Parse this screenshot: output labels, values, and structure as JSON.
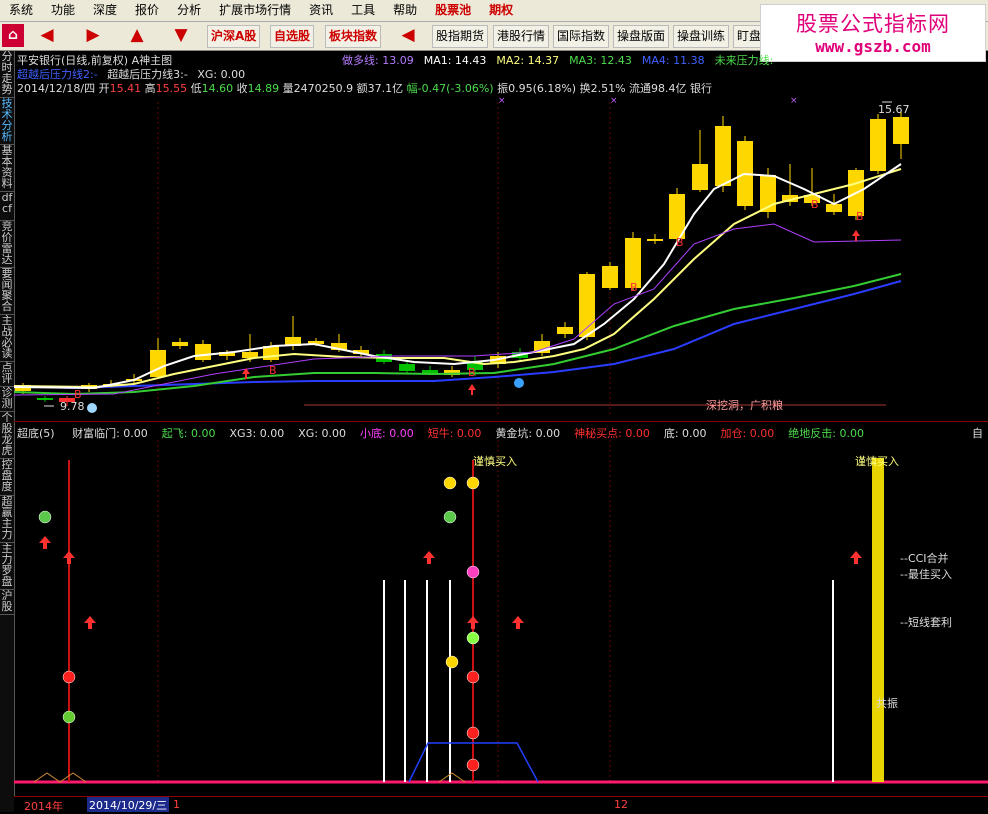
{
  "menu": [
    "系统",
    "功能",
    "深度",
    "报价",
    "分析",
    "扩展市场行情",
    "资讯",
    "工具",
    "帮助",
    "股票池",
    "期权"
  ],
  "watermark": {
    "line1": "股票公式指标网",
    "line2": "www.gszb.com"
  },
  "toolbar": {
    "tabs": [
      "沪深A股",
      "自选股",
      "板块指数",
      "股指期货",
      "港股行情",
      "国际指数",
      "操盘版面",
      "操盘训练",
      "盯盘"
    ]
  },
  "sidebar": [
    "分时走势",
    "技术分析",
    "基本资料",
    "dfcf",
    "竞价雷达",
    "要闻聚合",
    "主战必读",
    "点评",
    "诊测",
    "个股龙虎",
    "控盘度",
    "超赢主力",
    "主力罗盘",
    "沪股"
  ],
  "title_row": {
    "title": "平安银行(日线,前复权) A神主图",
    "items": [
      {
        "label": "做多线:",
        "value": "13.09",
        "color": "#b57cff"
      },
      {
        "label": "MA1:",
        "value": "14.43",
        "color": "#ffffff"
      },
      {
        "label": "MA2:",
        "value": "14.37",
        "color": "#ffff80"
      },
      {
        "label": "MA3:",
        "value": "12.43",
        "color": "#4cdc4c"
      },
      {
        "label": "MA4:",
        "value": "11.38",
        "color": "#4060ff"
      },
      {
        "label": "未来压力线:",
        "value": "",
        "color": "#4cdc4c"
      }
    ]
  },
  "row2": {
    "a": "超越后压力线2:-",
    "b": "超越后压力线3:-",
    "c": "XG: 0.00"
  },
  "quote": {
    "date": "2014/12/18/四",
    "open_l": "开",
    "open": "15.41",
    "high_l": "高",
    "high": "15.55",
    "low_l": "低",
    "low": "14.60",
    "close_l": "收",
    "close": "14.89",
    "vol": "量2470250.9",
    "amt": "额37.1亿",
    "chg": "幅-0.47(-3.06%)",
    "rest": "振0.95(6.18%) 换2.51% 流通98.4亿 银行"
  },
  "main_labels": {
    "max": "15.67",
    "min": "9.78",
    "dig": "深挖洞，广积粮"
  },
  "lower_row": {
    "name": "超底(5)",
    "items": [
      {
        "t": "财富临门: 0.00",
        "c": "#ddd"
      },
      {
        "t": "起飞: 0.00",
        "c": "#4cdc4c"
      },
      {
        "t": "XG3: 0.00",
        "c": "#ddd"
      },
      {
        "t": "XG: 0.00",
        "c": "#ddd"
      },
      {
        "t": "小底: 0.00",
        "c": "#ff40ff"
      },
      {
        "t": "短牛: 0.00",
        "c": "#ff3030"
      },
      {
        "t": "黄金坑: 0.00",
        "c": "#ddd"
      },
      {
        "t": "神秘买点: 0.00",
        "c": "#ff3030"
      },
      {
        "t": "底: 0.00",
        "c": "#ddd"
      },
      {
        "t": "加仓: 0.00",
        "c": "#ff3030"
      },
      {
        "t": "绝地反击: 0.00",
        "c": "#4cdc4c"
      }
    ],
    "tail": "自"
  },
  "lower_labels": {
    "buy1": "谨慎买入",
    "buy2": "谨慎买入",
    "n1": "--CCI合并",
    "n2": "--最佳买入",
    "n3": "--短线套利",
    "n4": "共振"
  },
  "xaxis": {
    "year": "2014年",
    "cursor": "2014/10/29/三",
    "one": "1",
    "m12": "12"
  },
  "chart_data": {
    "type": "candlestick",
    "title": "平安银行(日线,前复权)",
    "max_label": 15.67,
    "min_label": 9.78,
    "ma_last": {
      "做多线": 13.09,
      "MA1": 14.43,
      "MA2": 14.37,
      "MA3": 12.43,
      "MA4": 11.38
    }
  }
}
